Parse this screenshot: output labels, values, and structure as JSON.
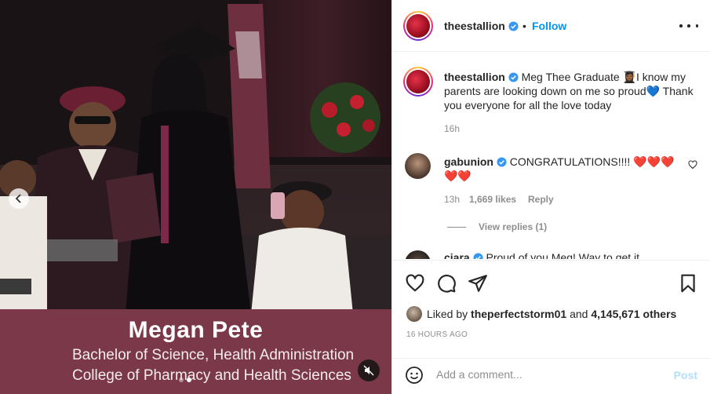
{
  "media": {
    "lower_third": {
      "name": "Megan Pete",
      "line1": "Bachelor of Science, Health Administration",
      "line2": "College of Pharmacy and Health Sciences"
    },
    "carousel": {
      "total": 2,
      "active": 2
    }
  },
  "post": {
    "username": "theestallion",
    "follow_label": "Follow",
    "dot": "•",
    "caption": {
      "username": "theestallion",
      "text": "Meg Thee Graduate 👩🏾‍🎓I know my parents are looking down on me so proud💙 Thank you everyone for all the love today",
      "time": "16h"
    },
    "comments": [
      {
        "username": "gabunion",
        "text": "CONGRATULATIONS!!!! ❤️❤️❤️❤️❤️",
        "time": "13h",
        "likes": "1,669 likes",
        "reply": "Reply",
        "view_replies": "View replies (1)"
      },
      {
        "username": "ciara",
        "text": "Proud of you Meg! Way to get it"
      }
    ],
    "liked_by_prefix": "Liked by",
    "liked_by_user": "theperfectstorm01",
    "liked_by_and": "and",
    "liked_by_others": "4,145,671 others",
    "timestamp": "16 HOURS AGO",
    "comment_placeholder": "Add a comment...",
    "post_label": "Post"
  },
  "colors": {
    "accent": "#0095f6",
    "post_disabled": "#b2dffc",
    "banner": "#7a3848",
    "verified": "#3897f0"
  },
  "icons": [
    "verified-badge-icon",
    "more-options-icon",
    "heart-icon",
    "comment-icon",
    "share-icon",
    "bookmark-icon",
    "emoji-icon",
    "muted-speaker-icon",
    "chevron-left-icon"
  ]
}
